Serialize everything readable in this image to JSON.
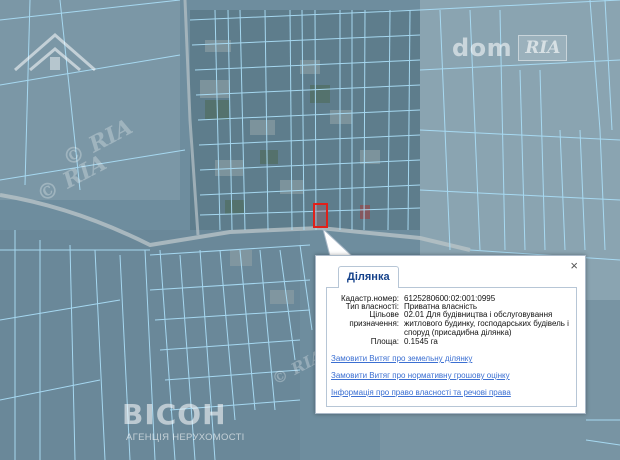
{
  "watermark": {
    "brand": "dom",
    "brand_badge": "RIA",
    "ghost_mark": "© RIA"
  },
  "agency": {
    "name": "ВІСОН",
    "tagline": "АГЕНЦІЯ НЕРУХОМОСТІ"
  },
  "popup": {
    "tab_label": "Ділянка",
    "close_symbol": "×",
    "fields": [
      {
        "label": "Кадастр.номер:",
        "value": "6125280600:02:001:0995"
      },
      {
        "label": "Тип власності:",
        "value": "Приватна власність"
      },
      {
        "label": "Цільове призначення:",
        "value": "02.01 Для будівництва і обслуговування житлового будинку, господарських будівель і споруд (присадибна ділянка)"
      },
      {
        "label": "Площа:",
        "value": "0.1545 га"
      }
    ],
    "links": [
      "Замовити Витяг про земельну ділянку",
      "Замовити Витяг про нормативну грошову оцінку",
      "Інформація про право власності та речові права"
    ]
  },
  "colors": {
    "parcel_line": "#a9dcf5",
    "marker": "#e0201a",
    "link": "#3b6fd2",
    "tab_text": "#15428b"
  }
}
